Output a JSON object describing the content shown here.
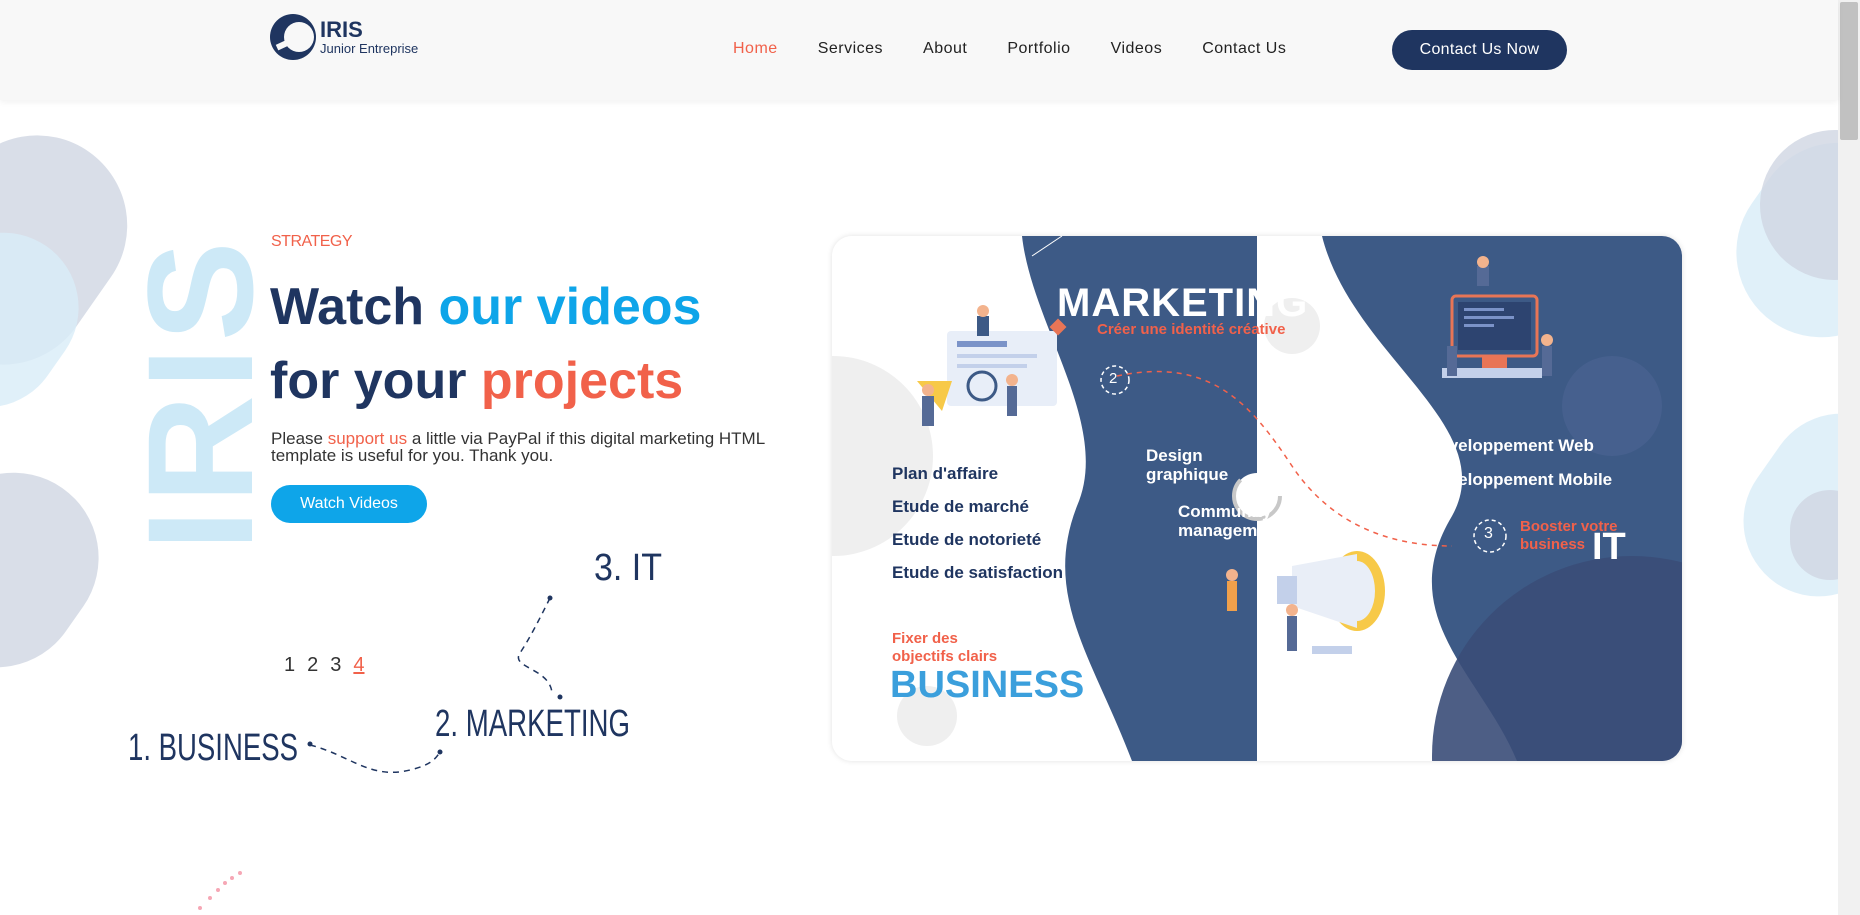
{
  "header": {
    "logo_title": "IRIS",
    "logo_subtitle": "Junior Entreprise",
    "nav": [
      "Home",
      "Services",
      "About",
      "Portfolio",
      "Videos",
      "Contact Us"
    ],
    "active_nav": "Home",
    "cta_label": "Contact Us Now"
  },
  "hero": {
    "vertical_word": "IRIS",
    "eyebrow": "STRATEGY",
    "title_part1": "Watch ",
    "title_part2": "our videos",
    "title_part3": "for your ",
    "title_part4": "projects",
    "desc_before": "Please ",
    "desc_link": "support us",
    "desc_after": " a little via PayPal if this digital marketing HTML template is useful for you. Thank you.",
    "button_label": "Watch Videos",
    "steps": [
      "1. BUSINESS",
      "2. MARKETING",
      "3. IT"
    ],
    "pager": [
      "1",
      "2",
      "3",
      "4"
    ],
    "pager_active": "4"
  },
  "card": {
    "marketing_title": "MARKETING",
    "marketing_sub": "Créer une identité créative",
    "business_items": [
      "Plan d'affaire",
      "Etude de marché",
      "Etude de notorieté",
      "Etude de satisfaction"
    ],
    "business_sub": "Fixer des objectifs clairs",
    "business_title": "BUSINESS",
    "design_label": "Design graphique",
    "community_label": "Community management",
    "it_items": [
      "Développement Web",
      "Développement Mobile"
    ],
    "it_sub": "Booster votre business",
    "it_title": "IT",
    "step2": "2",
    "step3": "3"
  },
  "colors": {
    "navy": "#1f3560",
    "accent_blue": "#0ea5e9",
    "accent_red": "#f1614a",
    "card_blue": "#3d5a86"
  }
}
